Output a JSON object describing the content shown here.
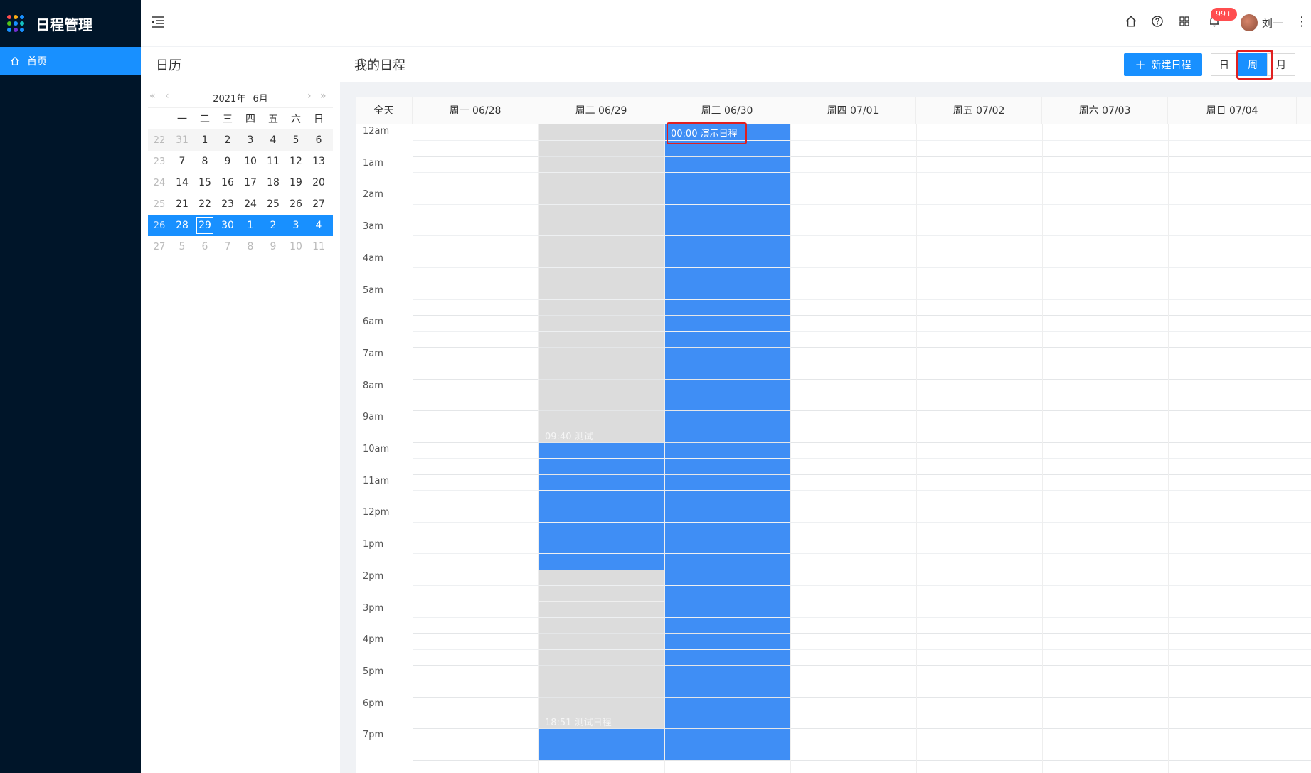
{
  "app": {
    "title": "日程管理",
    "brand_dot_colors": [
      "#ff4d4f",
      "#faad14",
      "#1890ff",
      "#52c41a",
      "#1890ff",
      "#13c2c2",
      "#1890ff",
      "#722ed1",
      "#1890ff"
    ]
  },
  "sidebar": {
    "items": [
      {
        "label": "首页",
        "icon": "home-icon",
        "active": true
      }
    ]
  },
  "header": {
    "icons": [
      "menu-fold-icon",
      "home-icon",
      "question-icon",
      "apps-icon",
      "bell-icon"
    ],
    "badge": "99+",
    "user": "刘一",
    "more": "⋮"
  },
  "calendar_panel": {
    "title": "日历",
    "year": "2021年",
    "month": "6月",
    "weekday_headers": [
      "一",
      "二",
      "三",
      "四",
      "五",
      "六",
      "日"
    ],
    "weeks": [
      {
        "week_no": "22",
        "days": [
          "31",
          "1",
          "2",
          "3",
          "4",
          "5",
          "6"
        ],
        "faded_first": 1
      },
      {
        "week_no": "23",
        "days": [
          "7",
          "8",
          "9",
          "10",
          "11",
          "12",
          "13"
        ]
      },
      {
        "week_no": "24",
        "days": [
          "14",
          "15",
          "16",
          "17",
          "18",
          "19",
          "20"
        ]
      },
      {
        "week_no": "25",
        "days": [
          "21",
          "22",
          "23",
          "24",
          "25",
          "26",
          "27"
        ]
      },
      {
        "week_no": "26",
        "days": [
          "28",
          "29",
          "30",
          "1",
          "2",
          "3",
          "4"
        ],
        "selected": true,
        "today": "29"
      },
      {
        "week_no": "27",
        "days": [
          "5",
          "6",
          "7",
          "8",
          "9",
          "10",
          "11"
        ],
        "faded_all": true
      }
    ]
  },
  "main": {
    "title": "我的日程",
    "new_button": "新建日程",
    "view_buttons": [
      {
        "label": "日"
      },
      {
        "label": "周",
        "active": true
      },
      {
        "label": "月"
      }
    ],
    "columns": [
      "全天",
      "周一 06/28",
      "周二 06/29",
      "周三 06/30",
      "周四 07/01",
      "周五 07/02",
      "周六 07/03",
      "周日 07/04"
    ],
    "time_labels": [
      "12am",
      "1am",
      "2am",
      "3am",
      "4am",
      "5am",
      "6am",
      "7am",
      "8am",
      "9am",
      "10am",
      "11am",
      "12pm",
      "1pm",
      "2pm",
      "3pm",
      "4pm",
      "5pm",
      "6pm",
      "7pm"
    ],
    "events": [
      {
        "label": "00:00 演示日程",
        "day_index": 2,
        "highlighted": true
      },
      {
        "label": "09:40 测试",
        "day_index": 1
      },
      {
        "label": "18:51 测试日程",
        "day_index": 1
      }
    ]
  }
}
